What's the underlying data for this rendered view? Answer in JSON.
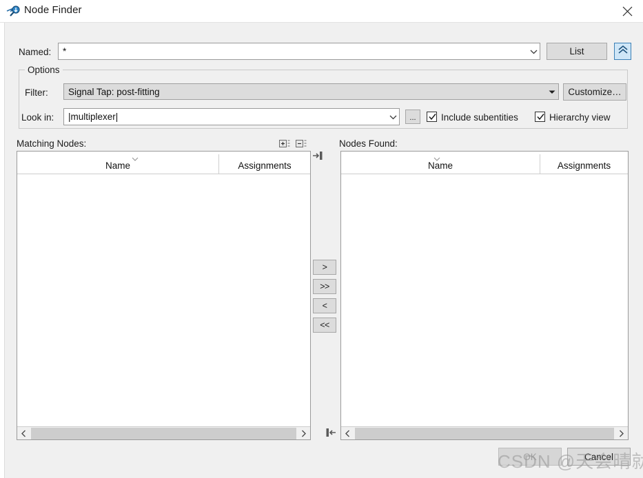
{
  "window": {
    "title": "Node Finder",
    "icon": "node-finder-magnifier-icon",
    "close_label": "✕"
  },
  "named": {
    "label": "Named:",
    "value": "*",
    "dropdown_icon": "chevron-down-icon"
  },
  "toolbar": {
    "list_label": "List",
    "collapse_icon": "double-chevron-up-icon"
  },
  "options": {
    "legend": "Options",
    "filter": {
      "label": "Filter:",
      "value": "Signal Tap: post-fitting",
      "dropdown_icon": "triangle-down-icon"
    },
    "customize_label": "Customize…",
    "look_in": {
      "label": "Look in:",
      "value": "|multiplexer|",
      "dropdown_icon": "chevron-down-icon",
      "browse_label": "..."
    },
    "include_subentities": {
      "label": "Include subentities",
      "checked": true
    },
    "hierarchy_view": {
      "label": "Hierarchy view",
      "checked": true
    }
  },
  "matching_nodes": {
    "title": "Matching Nodes:",
    "expand_all_icon": "expand-all-icon",
    "collapse_all_icon": "collapse-all-icon",
    "columns": [
      "Name",
      "Assignments"
    ],
    "rows": []
  },
  "nodes_found": {
    "title": "Nodes Found:",
    "columns": [
      "Name",
      "Assignments"
    ],
    "rows": []
  },
  "transfer": {
    "add_label": ">",
    "add_all_label": ">>",
    "remove_label": "<",
    "remove_all_label": "<<"
  },
  "splitter": {
    "top_icon": "collapse-right-icon",
    "bottom_icon": "collapse-left-icon"
  },
  "footer": {
    "ok_label": "OK",
    "ok_enabled": false,
    "cancel_label": "Cancel"
  },
  "watermark": "CSDN @天会晴就会暗",
  "colors": {
    "dialog_bg": "#f0f0f0",
    "accent_blue": "#3a7fb5",
    "accent_blue_fill": "#cfe6f7",
    "button_face": "#dcdcdc",
    "text": "#1b1b1b"
  }
}
